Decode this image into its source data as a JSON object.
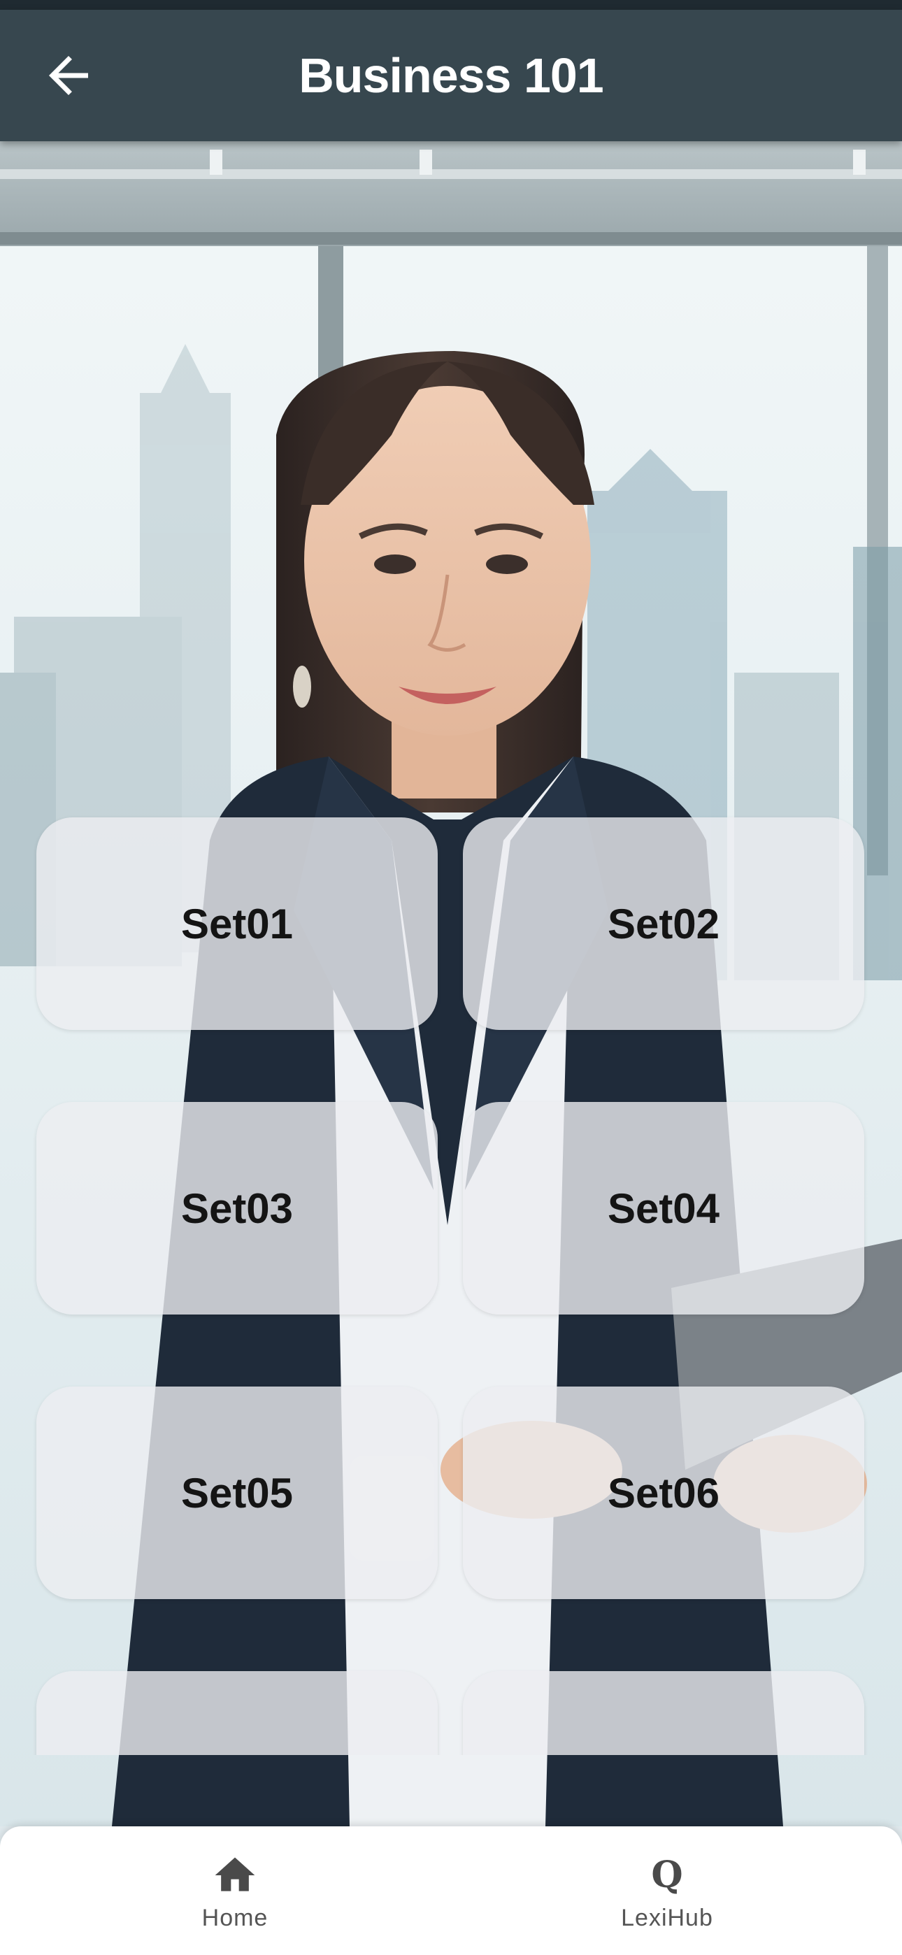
{
  "header": {
    "title": "Business 101",
    "back_icon": "arrow-left-icon",
    "background": "#37474f"
  },
  "background_image": {
    "subject": "businesswoman-office-photo"
  },
  "sets": [
    {
      "label": "Set01"
    },
    {
      "label": "Set02"
    },
    {
      "label": "Set03"
    },
    {
      "label": "Set04"
    },
    {
      "label": "Set05"
    },
    {
      "label": "Set06"
    },
    {
      "label": ""
    },
    {
      "label": ""
    }
  ],
  "bottom_nav": {
    "items": [
      {
        "label": "Home",
        "icon": "home-icon"
      },
      {
        "label": "LexiHub",
        "icon": "q-icon",
        "glyph": "Q"
      }
    ]
  },
  "colors": {
    "header_bg": "#37474f",
    "tile_bg": "rgba(236,238,241,0.80)",
    "nav_bg": "#ffffff"
  }
}
